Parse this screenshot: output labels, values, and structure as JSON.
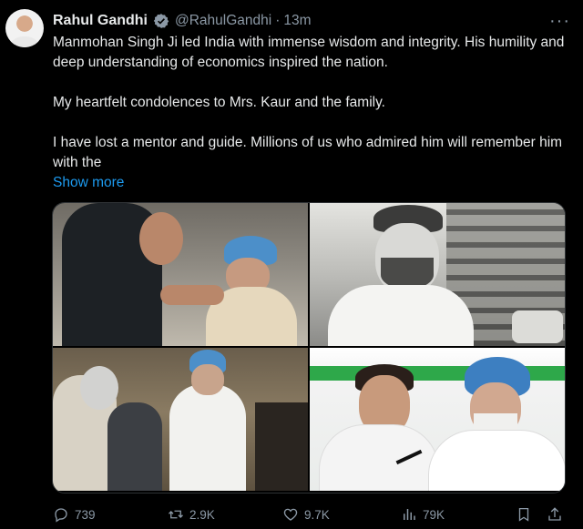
{
  "author": {
    "name": "Rahul Gandhi",
    "handle": "@RahulGandhi",
    "separator": "·",
    "time": "13m"
  },
  "tweet": {
    "paragraphs": [
      "Manmohan Singh Ji led India with immense wisdom and integrity. His humility and deep understanding of economics inspired the nation.",
      "My heartfelt condolences to Mrs. Kaur and the family.",
      "I have lost a mentor and guide. Millions of us who admired him will remember him with the"
    ],
    "show_more": "Show more"
  },
  "metrics": {
    "replies": "739",
    "reposts": "2.9K",
    "likes": "9.7K",
    "views": "79K"
  },
  "icons": {
    "verified": "verified-badge-icon",
    "more": "more-options-icon",
    "reply": "reply-icon",
    "repost": "repost-icon",
    "like": "heart-icon",
    "views": "views-chart-icon",
    "bookmark": "bookmark-icon",
    "share": "share-icon"
  },
  "colors": {
    "background": "#000000",
    "text": "#e7e9ea",
    "secondary": "#8b98a5",
    "link": "#1d9bf0"
  }
}
